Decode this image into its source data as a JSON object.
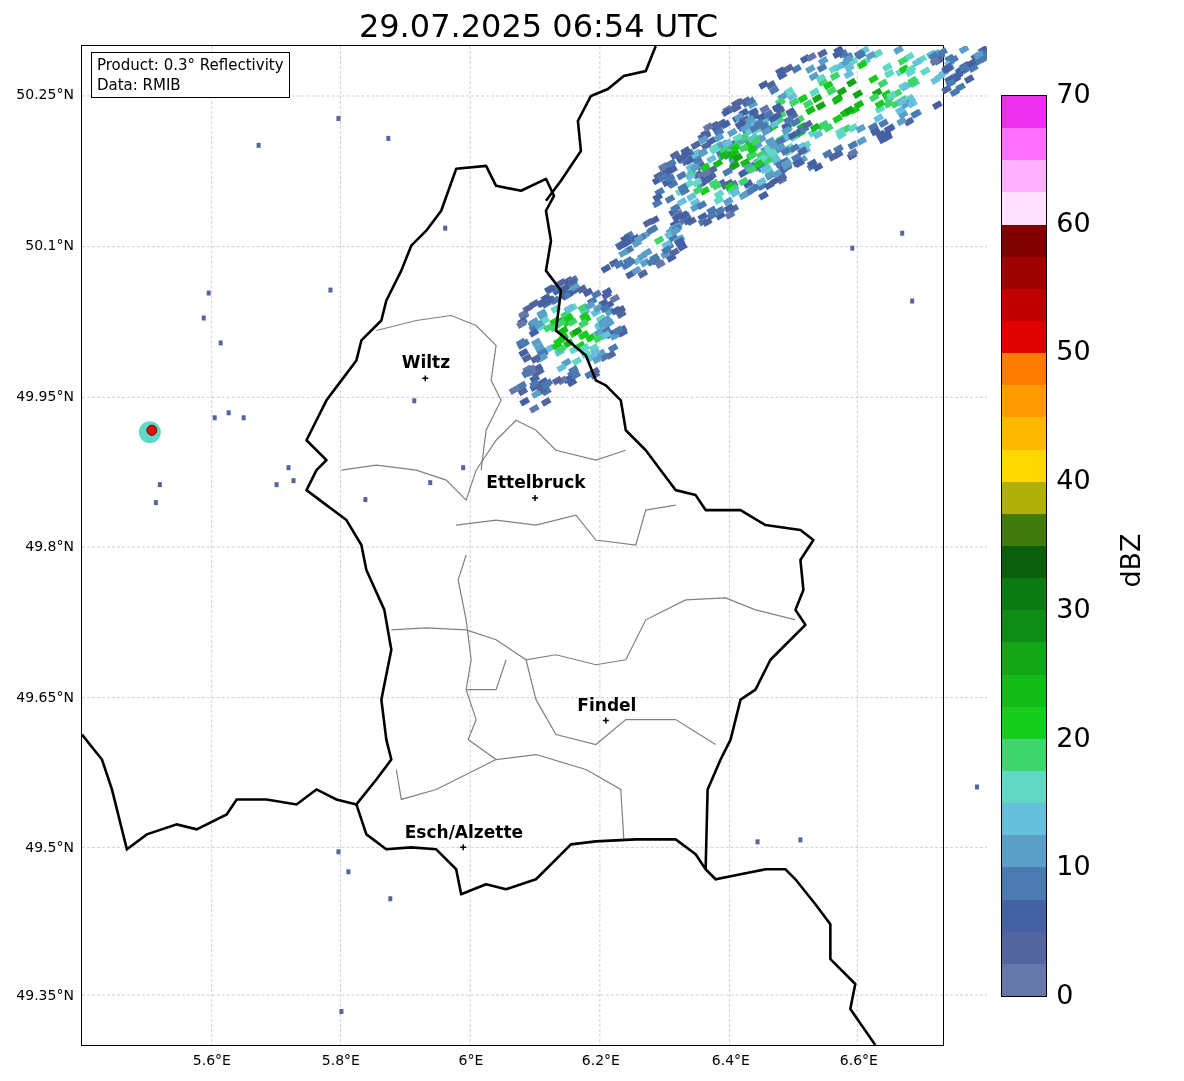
{
  "title": "29.07.2025 06:54 UTC",
  "legend": {
    "lines": [
      "Product: 0.3° Reflectivity",
      "Data: RMIB"
    ]
  },
  "map": {
    "y_ticks": [
      "50.25°N",
      "50.1°N",
      "49.95°N",
      "49.8°N",
      "49.65°N",
      "49.5°N",
      "49.35°N"
    ],
    "x_ticks": [
      "5.6°E",
      "5.8°E",
      "6°E",
      "6.2°E",
      "6.4°E",
      "6.6°E"
    ],
    "places": [
      {
        "name": "Wiltz"
      },
      {
        "name": "Ettelbruck"
      },
      {
        "name": "Findel"
      },
      {
        "name": "Esch/Alzette"
      }
    ]
  },
  "colorbar": {
    "label": "dBZ",
    "ticks": [
      "70",
      "60",
      "50",
      "40",
      "30",
      "20",
      "10",
      "0"
    ],
    "segments": [
      {
        "color": "#ee30ee"
      },
      {
        "color": "#ff70ff"
      },
      {
        "color": "#ffb0ff"
      },
      {
        "color": "#ffe0ff"
      },
      {
        "color": "#800000"
      },
      {
        "color": "#a00000"
      },
      {
        "color": "#c00000"
      },
      {
        "color": "#e00000"
      },
      {
        "color": "#ff7a00"
      },
      {
        "color": "#ff9a00"
      },
      {
        "color": "#ffb800"
      },
      {
        "color": "#ffd800"
      },
      {
        "color": "#b0b00a"
      },
      {
        "color": "#437a0c"
      },
      {
        "color": "#0a5e0c"
      },
      {
        "color": "#0c7a12"
      },
      {
        "color": "#0e8c16"
      },
      {
        "color": "#12a617"
      },
      {
        "color": "#12bb17"
      },
      {
        "color": "#16cc1c"
      },
      {
        "color": "#3ed66c"
      },
      {
        "color": "#60d8c4"
      },
      {
        "color": "#66c0dc"
      },
      {
        "color": "#5b9ec8"
      },
      {
        "color": "#4a7ab0"
      },
      {
        "color": "#4561a3"
      },
      {
        "color": "#52659f"
      },
      {
        "color": "#6677aa"
      }
    ]
  }
}
